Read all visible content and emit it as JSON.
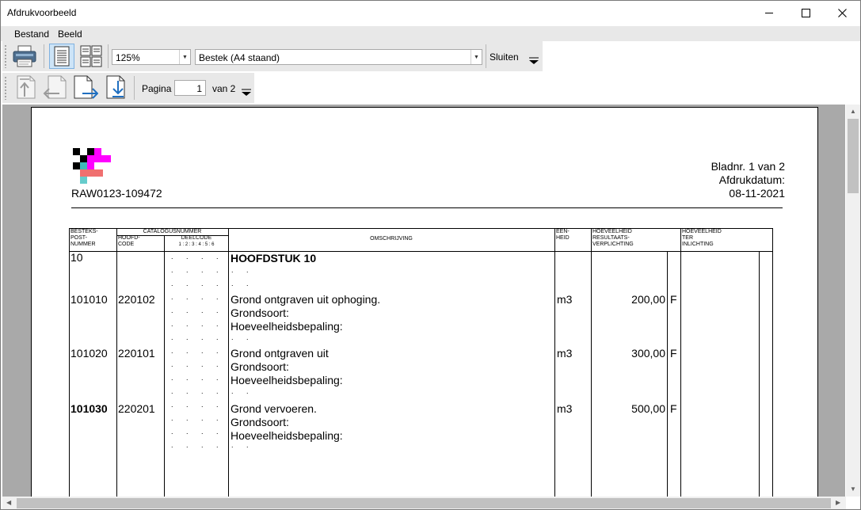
{
  "window": {
    "title": "Afdrukvoorbeeld"
  },
  "menu": {
    "items": [
      "Bestand",
      "Beeld"
    ]
  },
  "toolbar": {
    "zoom": "125%",
    "layout": "Bestek (A4 staand)",
    "close_label": "Sluiten",
    "page_label": "Pagina",
    "page_value": "1",
    "page_of": "van 2"
  },
  "document": {
    "code": "RAW0123-109472",
    "sheet": "Bladnr. 1 van 2",
    "print_date_label": "Afdrukdatum:",
    "print_date": "08-11-2021",
    "headers": {
      "besteks": "BESTEKS-",
      "post": "POST-",
      "nummer": "NUMMER",
      "catalogus": "CATALOGUSNUMMER",
      "hoofd": "HOOFD-",
      "code": "CODE",
      "deelcode": "DEELCODE",
      "deel_digits": "1 : 2 : 3 : 4 : 5 : 6",
      "omschrijving": "OMSCHRIJVING",
      "een": "EEN-",
      "heid": "HEID",
      "hoev1_a": "HOEVEELHEID",
      "hoev1_b": "RESULTAATS-",
      "hoev1_c": "VERPLICHTING",
      "hoev2_a": "HOEVEELHEID",
      "hoev2_b": "TER",
      "hoev2_c": "INLICHTING"
    },
    "chapter": {
      "number": "10",
      "title": "HOOFDSTUK 10"
    },
    "rows": [
      {
        "post": "101010",
        "code": "220102",
        "line1": "Grond ontgraven uit ophoging.",
        "line2": "Grondsoort:",
        "line3": "Hoeveelheidsbepaling:",
        "unit": "m3",
        "qty": "200,00",
        "flag": "F"
      },
      {
        "post": "101020",
        "code": "220101",
        "line1": "Grond ontgraven uit",
        "line2": "Grondsoort:",
        "line3": "Hoeveelheidsbepaling:",
        "unit": "m3",
        "qty": "300,00",
        "flag": "F"
      },
      {
        "post": "101030",
        "code": "220201",
        "line1": "Grond vervoeren.",
        "line2": "Grondsoort:",
        "line3": "Hoeveelheidsbepaling:",
        "unit": "m3",
        "qty": "500,00",
        "flag": "F"
      }
    ],
    "dotline": ". . . . . ."
  }
}
